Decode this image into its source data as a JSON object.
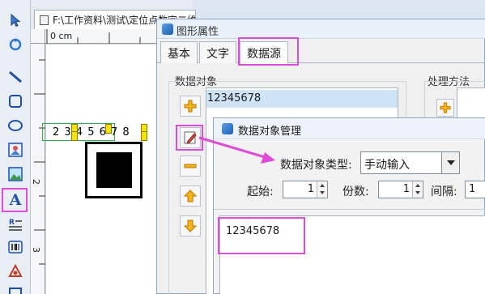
{
  "document": {
    "tab_title": "F:\\工作资料\\测试\\定位点数字二维码.zbl*",
    "ruler_unit": "0 cm",
    "ruler_v_marks": [
      "2",
      "3"
    ],
    "barcode_text": "2 3 4 5 6 7 8"
  },
  "dialog": {
    "title": "图形属性",
    "tabs": [
      "基本",
      "文字",
      "数据源"
    ],
    "active_tab": "数据源",
    "data_objects_label": "数据对象",
    "processing_label": "处理方法",
    "data_objects": [
      "12345678"
    ]
  },
  "sub_dialog": {
    "title": "数据对象管理",
    "type_label": "数据对象类型:",
    "type_value": "手动输入",
    "start_label": "起始:",
    "start_value": "1",
    "digits_label": "份数:",
    "digits_value": "1",
    "interval_label": "间隔:",
    "interval_value": "1",
    "content_value": "12345678"
  },
  "colors": {
    "highlight": "#e04ad8",
    "selection": "#cfe3f7",
    "handle": "#f5e400"
  }
}
